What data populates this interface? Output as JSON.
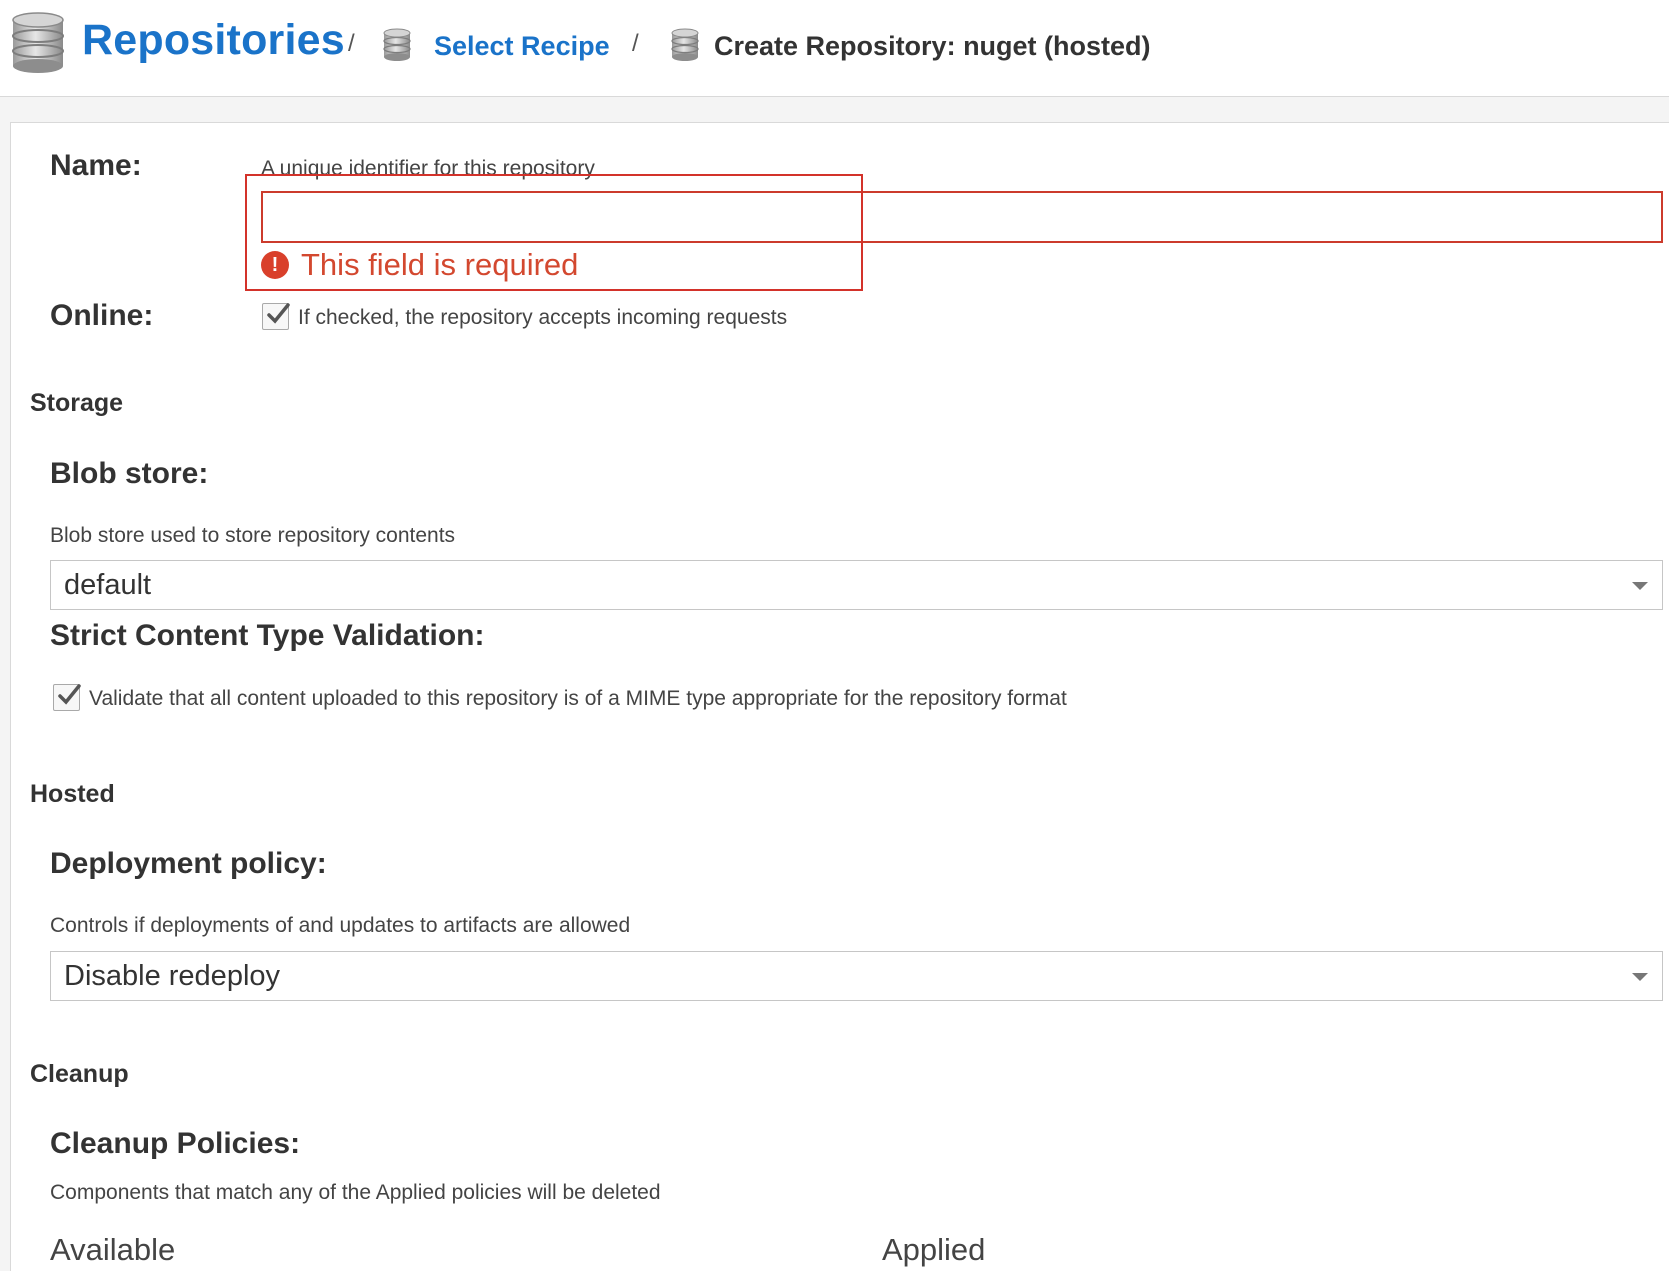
{
  "breadcrumb": {
    "root": {
      "label": "Repositories",
      "icon": "database-icon"
    },
    "separator": "/",
    "recipe": {
      "label": "Select Recipe",
      "icon": "database-icon"
    },
    "current": {
      "label": "Create Repository: nuget (hosted)",
      "icon": "database-icon"
    }
  },
  "form": {
    "name": {
      "label": "Name:",
      "help": "A unique identifier for this repository",
      "value": "",
      "error": "This field is required"
    },
    "online": {
      "label": "Online:",
      "checked": true,
      "help": "If checked, the repository accepts incoming requests"
    },
    "storage": {
      "section": "Storage",
      "blob_store": {
        "label": "Blob store:",
        "help": "Blob store used to store repository contents",
        "value": "default"
      },
      "strict": {
        "label": "Strict Content Type Validation:",
        "checked": true,
        "help": "Validate that all content uploaded to this repository is of a MIME type appropriate for the repository format"
      }
    },
    "hosted": {
      "section": "Hosted",
      "deployment": {
        "label": "Deployment policy:",
        "help": "Controls if deployments of and updates to artifacts are allowed",
        "value": "Disable redeploy"
      }
    },
    "cleanup": {
      "section": "Cleanup",
      "policies": {
        "label": "Cleanup Policies:",
        "help": "Components that match any of the Applied policies will be deleted",
        "available": "Available",
        "applied": "Applied"
      }
    }
  },
  "colors": {
    "link": "#1a73c9",
    "error": "#d3482f",
    "highlight": "#d3322a"
  }
}
